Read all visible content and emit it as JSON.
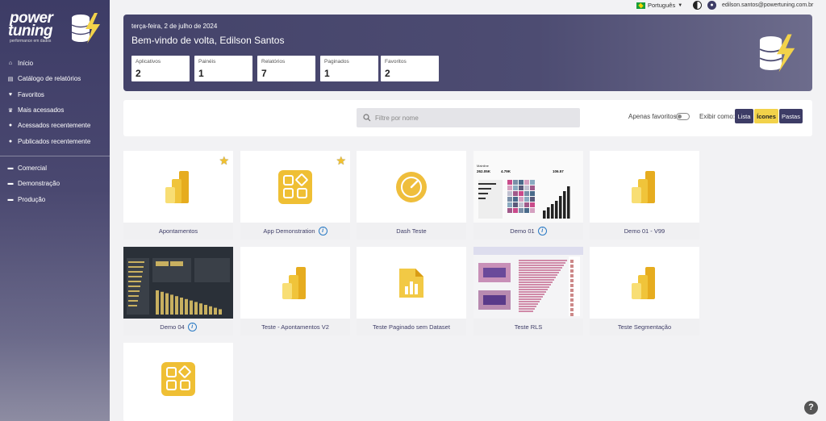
{
  "brand": {
    "line1": "power",
    "line2": "tuning",
    "tagline": "performance em dados"
  },
  "sidebar": {
    "main_items": [
      {
        "label": "Início",
        "icon": "home-icon"
      },
      {
        "label": "Catálogo de relatórios",
        "icon": "catalog-icon"
      },
      {
        "label": "Favoritos",
        "icon": "heart-icon"
      },
      {
        "label": "Mais acessados",
        "icon": "trophy-icon"
      },
      {
        "label": "Acessados recentemente",
        "icon": "clock-icon"
      },
      {
        "label": "Publicados recentemente",
        "icon": "clock-icon"
      }
    ],
    "folders": [
      {
        "label": "Comercial",
        "icon": "folder-icon"
      },
      {
        "label": "Demonstração",
        "icon": "folder-icon"
      },
      {
        "label": "Produção",
        "icon": "folder-icon"
      }
    ]
  },
  "topbar": {
    "language": "Português",
    "user_email": "edilson.santos@powertuning.com.br"
  },
  "header": {
    "date": "terça-feira, 2 de julho de 2024",
    "welcome": "Bem-vindo de volta, Edilson Santos",
    "stats": [
      {
        "label": "Aplicativos",
        "value": "2"
      },
      {
        "label": "Painéis",
        "value": "1"
      },
      {
        "label": "Relatórios",
        "value": "7"
      },
      {
        "label": "Paginados",
        "value": "1"
      },
      {
        "label": "Favoritos",
        "value": "2"
      }
    ]
  },
  "filter": {
    "search_placeholder": "Filtre por nome",
    "favorites_only_label": "Apenas favoritos",
    "show_as_label": "Exibir como:",
    "view_buttons": [
      "Lista",
      "Ícones",
      "Pastas"
    ],
    "active_view": "Ícones"
  },
  "items": [
    {
      "title": "Apontamentos",
      "type": "powerbi",
      "favorite": true,
      "info": false
    },
    {
      "title": "App Demonstration",
      "type": "app",
      "favorite": true,
      "info": true
    },
    {
      "title": "Dash Teste",
      "type": "dashboard",
      "favorite": false,
      "info": false
    },
    {
      "title": "Demo 01",
      "type": "thumb-demo01",
      "favorite": false,
      "info": true
    },
    {
      "title": "Demo 01 - V99",
      "type": "powerbi",
      "favorite": false,
      "info": false
    },
    {
      "title": "Demo 04",
      "type": "thumb-demo04",
      "favorite": false,
      "info": true
    },
    {
      "title": "Teste - Apontamentos V2",
      "type": "powerbi",
      "favorite": false,
      "info": false
    },
    {
      "title": "Teste Paginado sem Dataset",
      "type": "paginated",
      "favorite": false,
      "info": false
    },
    {
      "title": "Teste RLS",
      "type": "thumb-rls",
      "favorite": false,
      "info": false
    },
    {
      "title": "Teste Segmentação",
      "type": "powerbi",
      "favorite": false,
      "info": false
    },
    {
      "title": "",
      "type": "app",
      "favorite": false,
      "info": false
    }
  ],
  "thumb_demo01": {
    "kpis": [
      "262.05K",
      "4.79K",
      "106.57"
    ]
  }
}
